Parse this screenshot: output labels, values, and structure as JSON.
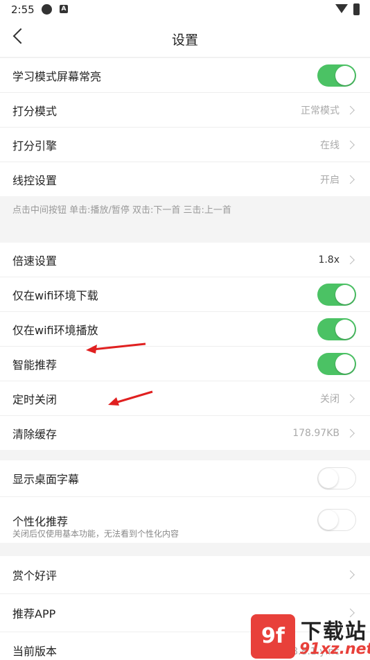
{
  "status_bar": {
    "time": "2:55",
    "notif_badge": "A"
  },
  "header": {
    "title": "设置"
  },
  "group1": {
    "rows": [
      {
        "label": "学习模式屏幕常亮",
        "toggle": "on"
      },
      {
        "label": "打分模式",
        "value": "正常模式"
      },
      {
        "label": "打分引擎",
        "value": "在线"
      },
      {
        "label": "线控设置",
        "value": "开启"
      }
    ],
    "note": "点击中间按钮 单击:播放/暂停 双击:下一首 三击:上一首"
  },
  "group2": {
    "rows": [
      {
        "label": "倍速设置",
        "value": "1.8x"
      },
      {
        "label": "仅在wifi环境下载",
        "toggle": "on"
      },
      {
        "label": "仅在wifi环境播放",
        "toggle": "on"
      },
      {
        "label": "智能推荐",
        "toggle": "on"
      },
      {
        "label": "定时关闭",
        "value": "关闭"
      },
      {
        "label": "清除缓存",
        "value": "178.97KB"
      }
    ]
  },
  "group3": {
    "rows": [
      {
        "label": "显示桌面字幕",
        "toggle": "off"
      },
      {
        "label": "个性化推荐",
        "sublabel": "关闭后仅使用基本功能，无法看到个性化内容",
        "toggle": "off"
      }
    ]
  },
  "group4": {
    "rows": [
      {
        "label": "赏个好评"
      },
      {
        "label": "推荐APP"
      },
      {
        "label": "当前版本",
        "value": "v4.8.8.1.yinc"
      }
    ]
  },
  "watermark": {
    "logo": "9f",
    "text_top": "下载站",
    "text_bottom": "91xz.net"
  },
  "colors": {
    "toggle_on": "#4bc264",
    "annotation_arrow": "#e02020",
    "watermark_red": "#e8403a"
  }
}
